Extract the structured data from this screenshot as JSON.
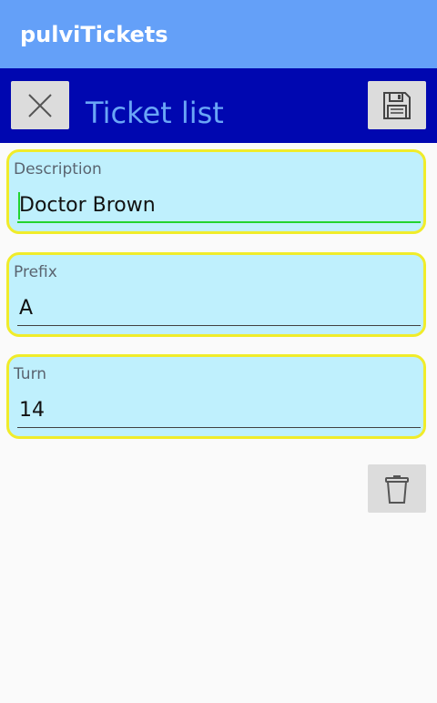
{
  "app": {
    "title": "pulviTickets"
  },
  "toolbar": {
    "title": "Ticket list",
    "close_icon": "close-icon",
    "save_icon": "floppy-disk-icon"
  },
  "form": {
    "description": {
      "label": "Description",
      "value": "Doctor Brown"
    },
    "prefix": {
      "label": "Prefix",
      "value": "A"
    },
    "turn": {
      "label": "Turn",
      "value": "14"
    }
  },
  "actions": {
    "delete_icon": "trash-icon"
  },
  "colors": {
    "appbar": "#64a0f8",
    "toolbar": "#0007b0",
    "toolbar_title": "#6aa6f6",
    "field_bg": "#bff0fd",
    "field_border": "#f0ec2a",
    "focus_accent": "#22d42e",
    "button_bg": "#dcdcdc"
  }
}
